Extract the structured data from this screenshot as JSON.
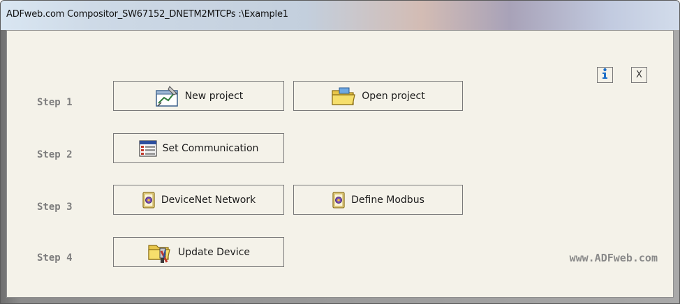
{
  "window": {
    "title": "ADFweb.com Compositor_SW67152_DNETM2MTCPs :\\Example1"
  },
  "steps": [
    {
      "label": "Step 1"
    },
    {
      "label": "Step 2"
    },
    {
      "label": "Step 3"
    },
    {
      "label": "Step 4"
    }
  ],
  "buttons": {
    "new_project": {
      "label": "New project",
      "icon": "new-project-icon"
    },
    "open_project": {
      "label": "Open project",
      "icon": "folder-open-icon"
    },
    "set_communication": {
      "label": "Set Communication",
      "icon": "settings-table-icon"
    },
    "devicenet_network": {
      "label": "DeviceNet Network",
      "icon": "device-icon"
    },
    "define_modbus": {
      "label": "Define Modbus",
      "icon": "device-icon"
    },
    "update_device": {
      "label": "Update Device",
      "icon": "update-folder-icon"
    }
  },
  "info_button": {
    "icon": "info-icon"
  },
  "close_button": {
    "label": "X"
  },
  "footer": {
    "url": "www.ADFweb.com"
  }
}
